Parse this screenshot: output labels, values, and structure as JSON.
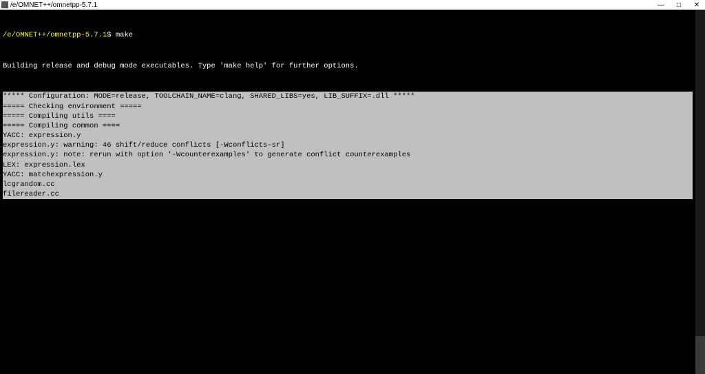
{
  "window": {
    "title": "/e/OMNET++/omnetpp-5.7.1",
    "controls": {
      "minimize": "—",
      "maximize": "□",
      "close": "✕"
    }
  },
  "terminal": {
    "prompt_path": "/e/OMNET++/omnetpp-5.7.1",
    "prompt_suffix": "$ ",
    "command": "make",
    "white_output": "Building release and debug mode executables. Type 'make help' for further options.",
    "lines": [
      "***** Configuration: MODE=release, TOOLCHAIN_NAME=clang, SHARED_LIBS=yes, LIB_SUFFIX=.dll *****",
      "===== Checking environment =====",
      "===== Compiling utils ====",
      "===== Compiling common ====",
      "YACC: expression.y",
      "expression.y: warning: 46 shift/reduce conflicts [-Wconflicts-sr]",
      "expression.y: note: rerun with option '-Wcounterexamples' to generate conflict counterexamples",
      "LEX: expression.lex",
      "YACC: matchexpression.y",
      "lcgrandom.cc",
      "filereader.cc"
    ]
  }
}
